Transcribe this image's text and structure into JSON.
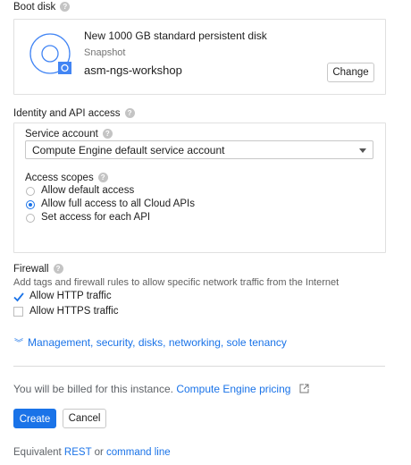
{
  "boot_disk": {
    "title": "Boot disk",
    "disk_name": "New 1000 GB standard persistent disk",
    "source_type": "Snapshot",
    "snapshot_name": "asm-ngs-workshop",
    "change_label": "Change"
  },
  "identity": {
    "title": "Identity and API access",
    "service_account_label": "Service account",
    "service_account_value": "Compute Engine default service account",
    "access_scopes_label": "Access scopes",
    "scopes": [
      {
        "label": "Allow default access",
        "selected": false
      },
      {
        "label": "Allow full access to all Cloud APIs",
        "selected": true
      },
      {
        "label": "Set access for each API",
        "selected": false
      }
    ]
  },
  "firewall": {
    "title": "Firewall",
    "description": "Add tags and firewall rules to allow specific network traffic from the Internet",
    "options": [
      {
        "label": "Allow HTTP traffic",
        "checked": true
      },
      {
        "label": "Allow HTTPS traffic",
        "checked": false
      }
    ]
  },
  "more": {
    "expander_label": "Management, security, disks, networking, sole tenancy"
  },
  "billing": {
    "text": "You will be billed for this instance.",
    "pricing_link": "Compute Engine pricing"
  },
  "actions": {
    "create_label": "Create",
    "cancel_label": "Cancel"
  },
  "equivalent": {
    "prefix": "Equivalent",
    "rest_link": "REST",
    "or_text": "or",
    "cli_link": "command line"
  }
}
